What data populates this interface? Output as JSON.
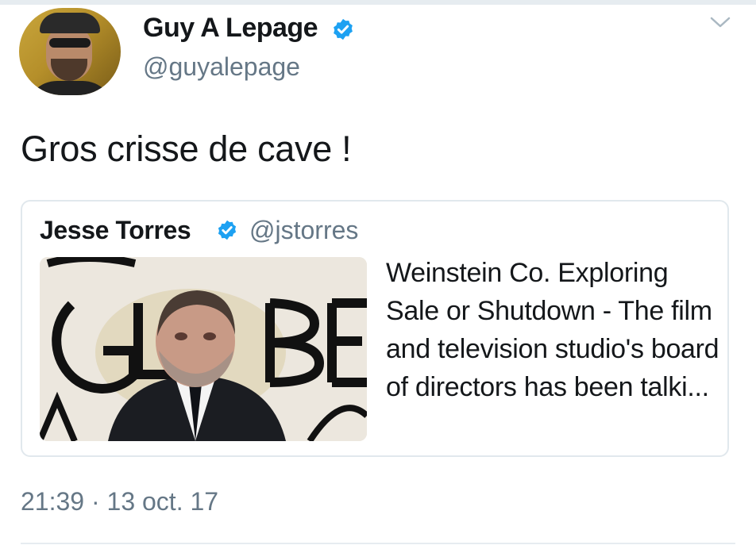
{
  "tweet": {
    "author_name": "Guy A Lepage",
    "author_handle": "@guyalepage",
    "text": "Gros crisse de cave !",
    "timestamp": "21:39 · 13 oct. 17"
  },
  "quoted_tweet": {
    "author_name": "Jesse Torres",
    "author_handle": "@jstorres",
    "summary": "Weinstein Co. Exploring Sale or Shutdown - The film and television studio's board of directors has been talki..."
  },
  "icons": {
    "verified": "verified-badge-icon",
    "menu": "chevron-down-icon"
  },
  "colors": {
    "verified_blue": "#1da1f2",
    "secondary_text": "#657786",
    "border": "#e1e8ed"
  }
}
